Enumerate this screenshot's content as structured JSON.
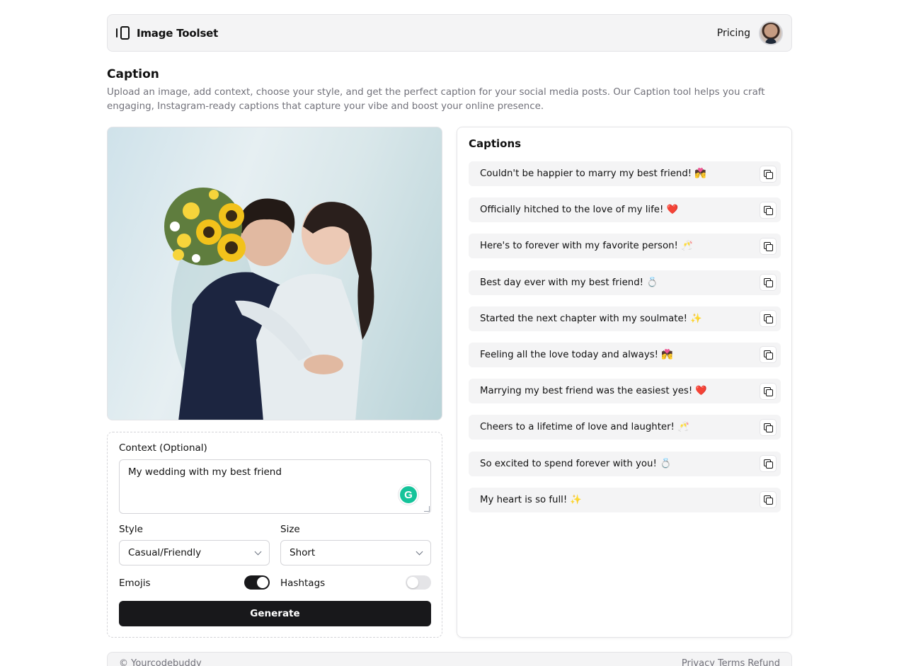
{
  "header": {
    "brand": "Image Toolset",
    "pricing_label": "Pricing"
  },
  "page": {
    "title": "Caption",
    "description": "Upload an image, add context, choose your style, and get the perfect caption for your social media posts. Our Caption tool helps you craft engaging, Instagram-ready captions that capture your vibe and boost your online presence."
  },
  "form": {
    "context_label": "Context (Optional)",
    "context_value": "My wedding with my best friend",
    "style_label": "Style",
    "style_value": "Casual/Friendly",
    "size_label": "Size",
    "size_value": "Short",
    "emojis_label": "Emojis",
    "emojis_enabled": true,
    "hashtags_label": "Hashtags",
    "hashtags_enabled": false,
    "generate_label": "Generate"
  },
  "captions": {
    "title": "Captions",
    "items": [
      "Couldn't be happier to marry my best friend! 💏",
      "Officially hitched to the love of my life! ❤️",
      "Here's to forever with my favorite person! 🥂",
      "Best day ever with my best friend! 💍",
      "Started the next chapter with my soulmate! ✨",
      "Feeling all the love today and always! 💏",
      "Marrying my best friend was the easiest yes! ❤️",
      "Cheers to a lifetime of love and laughter! 🥂",
      "So excited to spend forever with you! 💍",
      "My heart is so full! ✨"
    ]
  },
  "footer": {
    "copyright": "© Yourcodebuddy",
    "links": [
      "Privacy",
      "Terms",
      "Refund"
    ]
  }
}
